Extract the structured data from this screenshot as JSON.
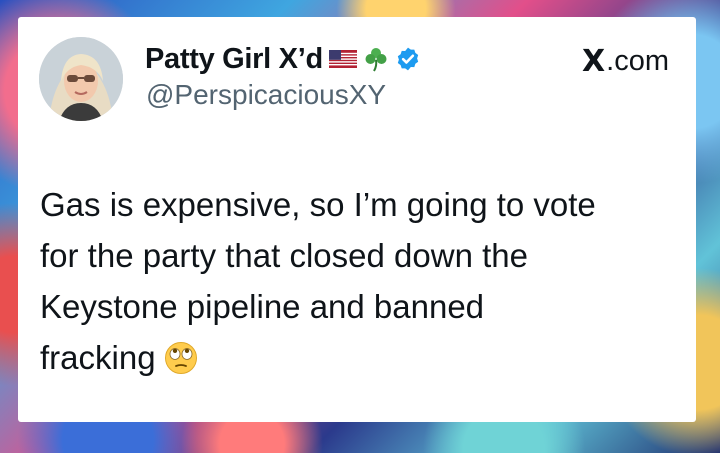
{
  "tweet": {
    "author_name": "Patty Girl X’d",
    "handle": "@PerspicaciousXY",
    "badges": [
      "us-flag-icon",
      "shamrock-icon",
      "verified-badge-icon"
    ],
    "brand": ".com",
    "brand_mark": "X",
    "text_lines": [
      "Gas is expensive, so I’m going to vote",
      "for the party that closed down the",
      "Keystone pipeline and banned",
      "fracking"
    ],
    "end_emoji": "eye-roll-emoji-icon"
  },
  "colors": {
    "text": "#0f1419",
    "secondary_text": "#536471",
    "verified_blue": "#1d9bf0",
    "card_background": "#ffffff"
  }
}
